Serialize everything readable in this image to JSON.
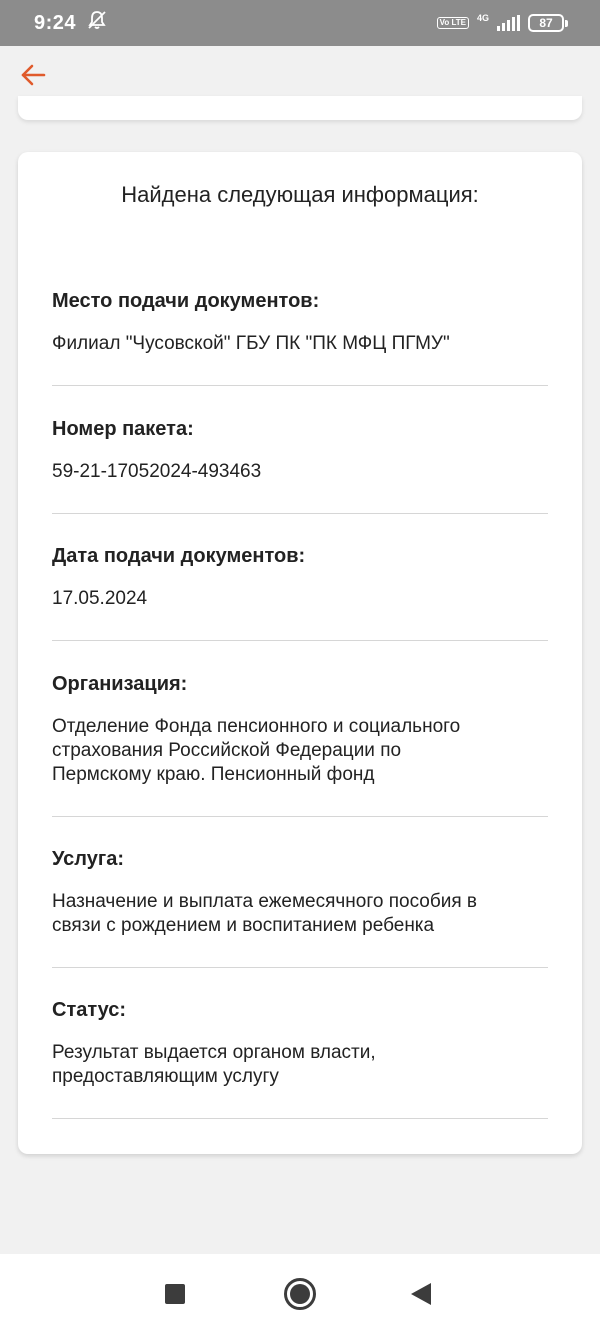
{
  "status_bar": {
    "time": "9:24",
    "volte_label": "Vo LTE",
    "network_label": "4G",
    "battery": "87"
  },
  "app_bar": {
    "back_icon": "arrow-left-icon",
    "accent_color": "#e05a2b"
  },
  "card": {
    "title": "Найдена следующая информация:",
    "fields": [
      {
        "label": "Место подачи документов:",
        "value": "Филиал \"Чусовской\" ГБУ ПК \"ПК МФЦ ПГМУ\""
      },
      {
        "label": "Номер пакета:",
        "value": "59-21-17052024-493463"
      },
      {
        "label": "Дата подачи документов:",
        "value": "17.05.2024"
      },
      {
        "label": "Организация:",
        "value": "Отделение Фонда пенсионного и социального\nстрахования Российской Федерации по\nПермскому краю. Пенсионный фонд"
      },
      {
        "label": "Услуга:",
        "value": "Назначение и выплата ежемесячного пособия в\nсвязи с рождением и воспитанием ребенка"
      },
      {
        "label": "Статус:",
        "value": "Результат выдается органом власти,\nпредоставляющим услугу"
      }
    ]
  },
  "nav_bar": {
    "recents_icon": "square-icon",
    "home_icon": "circle-icon",
    "back_icon": "triangle-back-icon"
  }
}
